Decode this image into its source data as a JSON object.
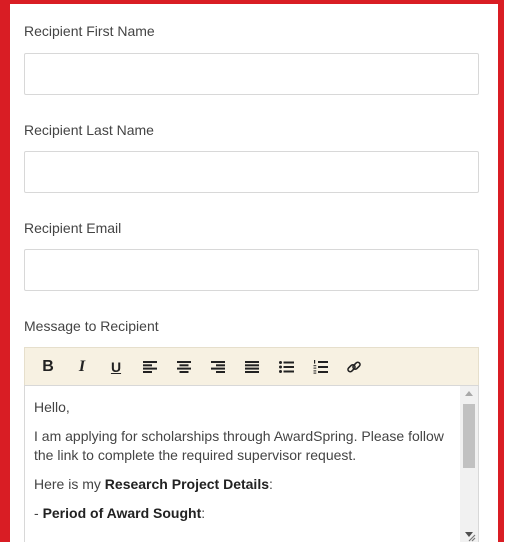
{
  "fields": {
    "first_name": {
      "label": "Recipient First Name",
      "value": ""
    },
    "last_name": {
      "label": "Recipient Last Name",
      "value": ""
    },
    "email": {
      "label": "Recipient Email",
      "value": ""
    },
    "message": {
      "label": "Message to Recipient"
    }
  },
  "toolbar": {
    "bold": "B",
    "italic": "I",
    "underline": "U",
    "buttons": [
      "bold",
      "italic",
      "underline",
      "align-left",
      "align-center",
      "align-right",
      "align-justify",
      "bullet-list",
      "numbered-list",
      "link"
    ]
  },
  "editor": {
    "greeting": "Hello,",
    "intro": "I am applying for scholarships through AwardSpring. Please follow the link to complete the required supervisor request.",
    "details_prefix": "Here is my ",
    "details_bold": "Research Project Details",
    "details_suffix": ":",
    "period_prefix": "- ",
    "period_bold": "Period of Award Sought",
    "period_suffix": ":"
  },
  "colors": {
    "frame": "#d91d24",
    "toolbar_bg": "#f7f1e2"
  }
}
